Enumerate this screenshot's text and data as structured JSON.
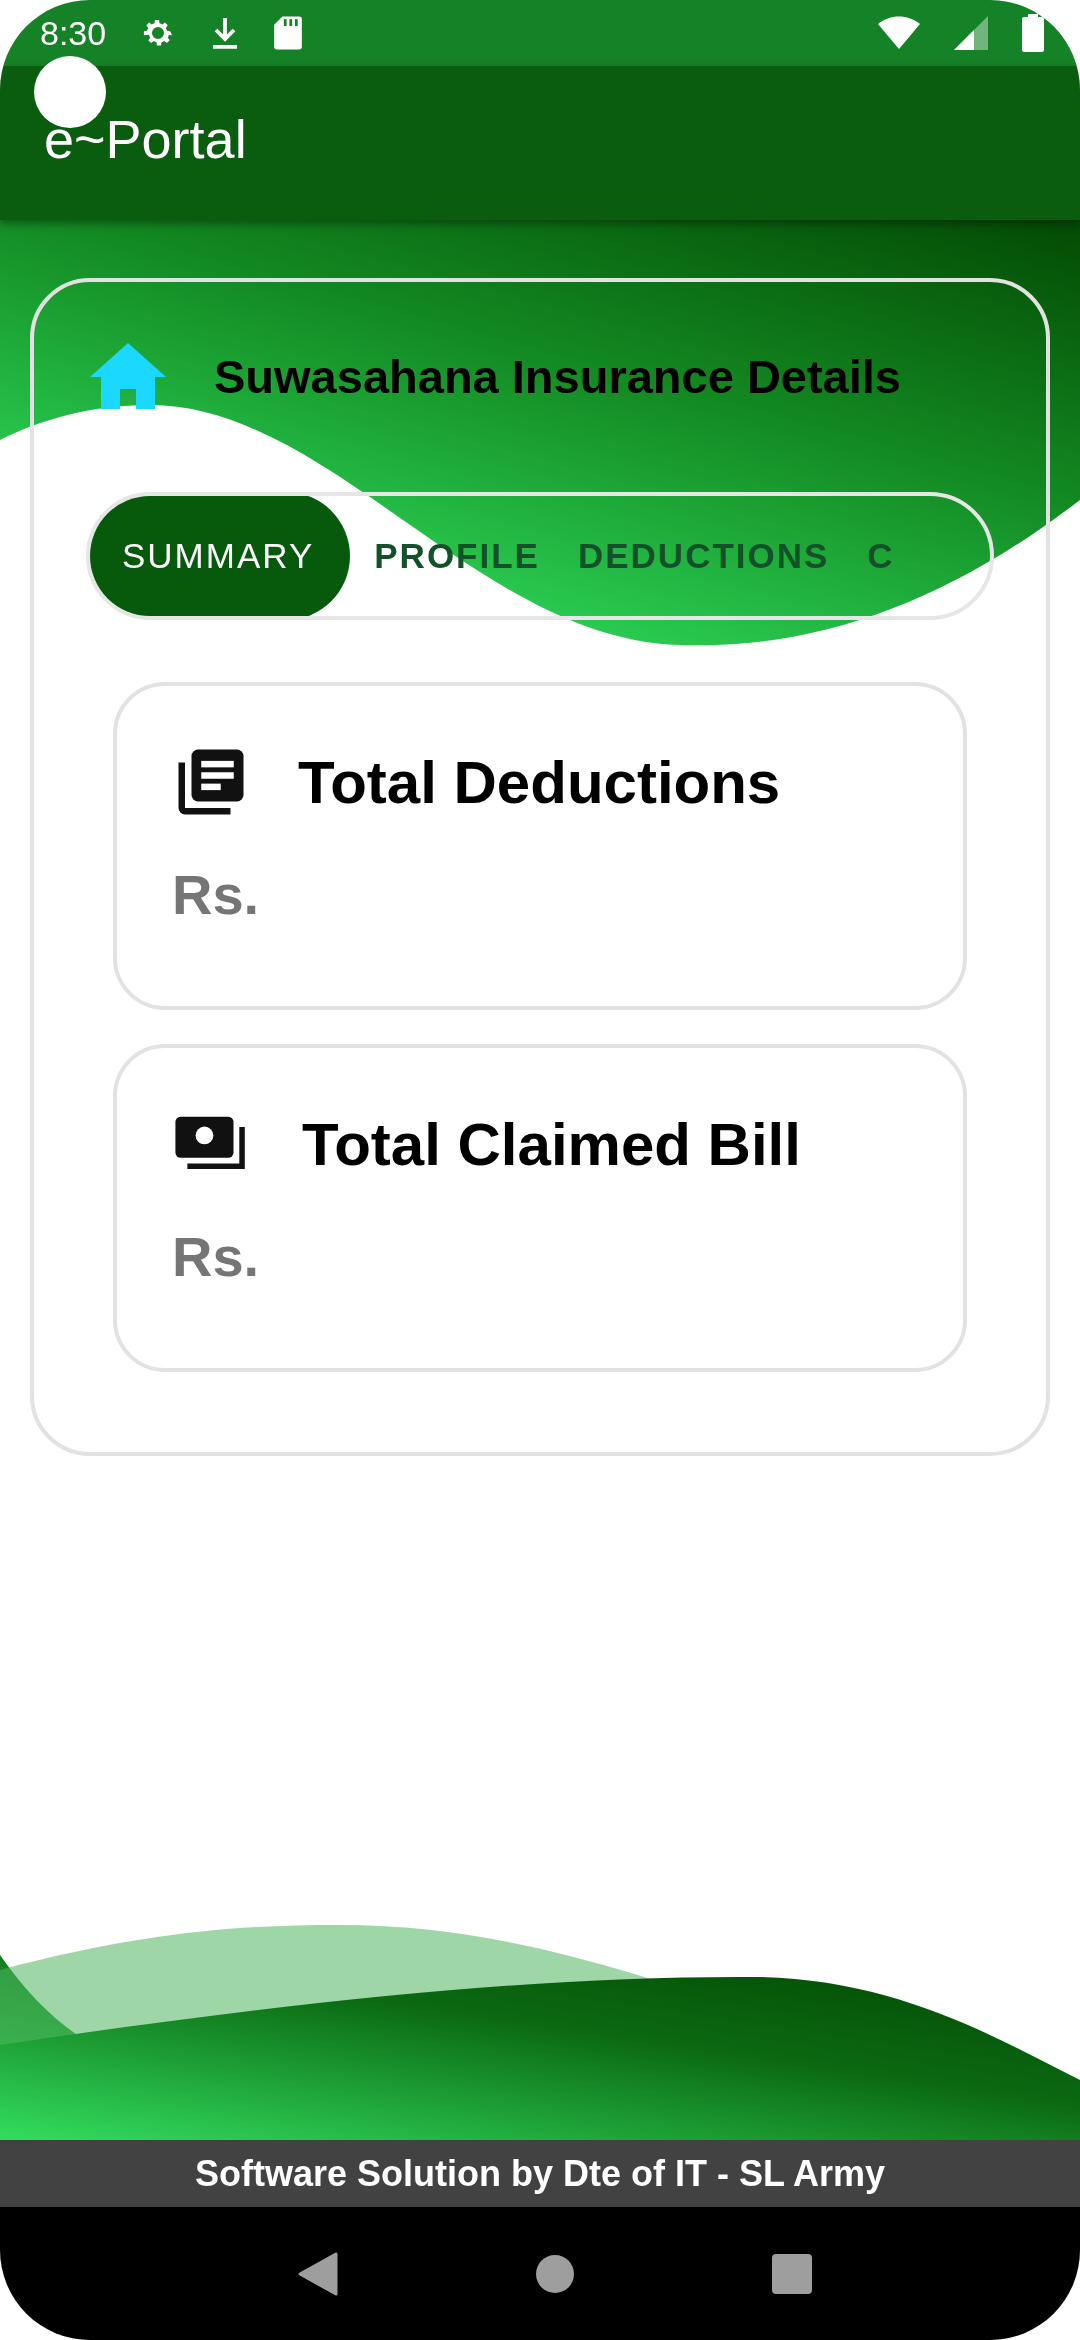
{
  "status_bar": {
    "time": "8:30"
  },
  "app_bar": {
    "title": "e~Portal"
  },
  "details": {
    "title": "Suwasahana Insurance Details",
    "tabs": [
      {
        "label": "SUMMARY",
        "selected": true
      },
      {
        "label": "PROFILE",
        "selected": false
      },
      {
        "label": "DEDUCTIONS",
        "selected": false
      },
      {
        "label": "C",
        "selected": false
      }
    ],
    "cards": [
      {
        "kind": "deductions",
        "title": "Total Deductions",
        "amount": "Rs."
      },
      {
        "kind": "bill",
        "title": "Total Claimed Bill",
        "amount": "Rs."
      }
    ]
  },
  "footer": {
    "text": "Software Solution by Dte of IT - SL Army"
  }
}
